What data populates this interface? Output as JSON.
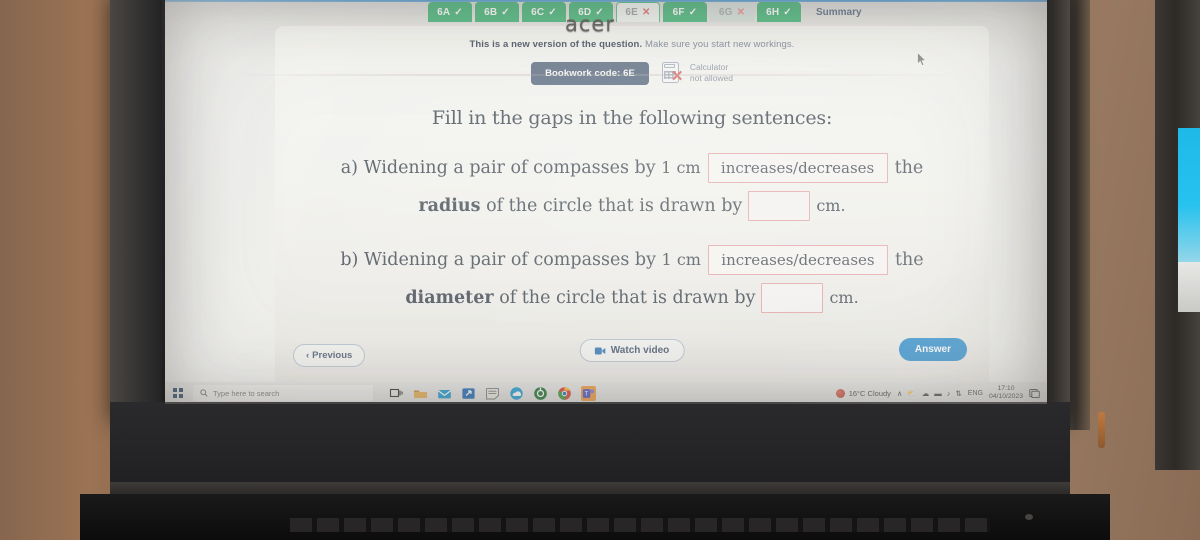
{
  "device": {
    "brand_logo": "acer"
  },
  "browser": {
    "top_bar_color": "#3d93d4"
  },
  "tabs": [
    {
      "label": "6A",
      "mark": "✓",
      "state": "done"
    },
    {
      "label": "6B",
      "mark": "✓",
      "state": "done"
    },
    {
      "label": "6C",
      "mark": "✓",
      "state": "done"
    },
    {
      "label": "6D",
      "mark": "✓",
      "state": "done"
    },
    {
      "label": "6E",
      "mark": "✕",
      "state": "active"
    },
    {
      "label": "6F",
      "mark": "✓",
      "state": "done"
    },
    {
      "label": "6G",
      "mark": "✕",
      "state": "pending"
    },
    {
      "label": "6H",
      "mark": "✓",
      "state": "done"
    }
  ],
  "summary_tab": {
    "label": "Summary"
  },
  "notice": {
    "bold": "This is a new version of the question.",
    "rest": " Make sure you start new workings."
  },
  "bookwork": {
    "label": "Bookwork code: 6E"
  },
  "calculator": {
    "line1": "Calculator",
    "line2": "not allowed",
    "icon": "calculator-not-allowed-icon"
  },
  "question": {
    "title": "Fill in the gaps in the following sentences:",
    "parts": [
      {
        "label": "a)",
        "line1_pre": "Widening a pair of compasses by",
        "line1_value": "1 cm",
        "dropdown_value": "increases/decreases",
        "line1_post": "the",
        "line2_bold": "radius",
        "line2_mid": "of the circle that is drawn by",
        "gap_value": "",
        "line2_unit": "cm."
      },
      {
        "label": "b)",
        "line1_pre": "Widening a pair of compasses by",
        "line1_value": "1 cm",
        "dropdown_value": "increases/decreases",
        "line1_post": "the",
        "line2_bold": "diameter",
        "line2_mid": "of the circle that is drawn by",
        "gap_value": "",
        "line2_unit": "cm."
      }
    ]
  },
  "footer": {
    "previous": "Previous",
    "previous_chevron": "‹",
    "watch_video": "Watch video",
    "answer": "Answer",
    "answer_color": "#2f8fd0"
  },
  "taskbar": {
    "search_placeholder": "Type here to search",
    "icons": [
      "task-view-icon",
      "file-explorer-icon",
      "mail-icon",
      "store-icon",
      "sticky-notes-icon",
      "onedrive-icon",
      "media-icon",
      "chrome-icon",
      "teams-icon"
    ],
    "weather": "16°C  Cloudy",
    "tray_glyphs": [
      "∧",
      "⛅",
      "☁",
      "▬",
      "♪",
      "⇅"
    ],
    "language": "ENG",
    "time": "17:10",
    "date": "04/10/2023",
    "notification_icon": "notification-icon"
  }
}
